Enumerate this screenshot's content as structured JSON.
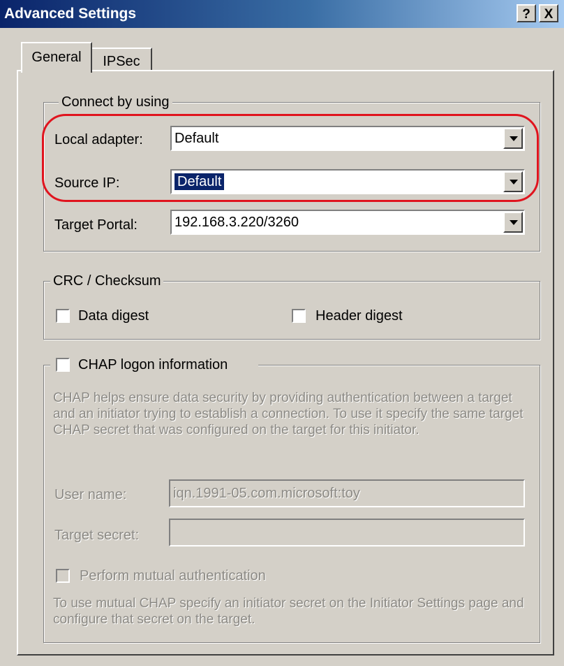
{
  "window": {
    "title": "Advanced Settings",
    "help_button": "?",
    "close_button": "X"
  },
  "tabs": [
    {
      "label": "General",
      "active": true
    },
    {
      "label": "IPSec",
      "active": false
    }
  ],
  "connect_group": {
    "legend": "Connect by using",
    "local_adapter": {
      "label": "Local adapter:",
      "value": "Default"
    },
    "source_ip": {
      "label": "Source IP:",
      "value": "Default"
    },
    "target_portal": {
      "label": "Target Portal:",
      "value": "192.168.3.220/3260"
    }
  },
  "crc_group": {
    "legend": "CRC / Checksum",
    "data_digest": {
      "label": "Data digest",
      "checked": false
    },
    "header_digest": {
      "label": "Header digest",
      "checked": false
    }
  },
  "chap_group": {
    "legend": "CHAP logon information",
    "checked": false,
    "description": "CHAP helps ensure data security by providing authentication between a target and an initiator trying to establish a connection. To use it specify the same target CHAP secret that was configured on the target for this initiator.",
    "user_name": {
      "label": "User name:",
      "value": "iqn.1991-05.com.microsoft:toy"
    },
    "target_secret": {
      "label": "Target secret:",
      "value": ""
    },
    "mutual_auth": {
      "label": "Perform mutual authentication",
      "checked": false
    },
    "mutual_note": "To use mutual CHAP specify an initiator secret on the Initiator Settings page and configure that secret on the target."
  },
  "annotation": {
    "highlight_color": "#e0141e"
  },
  "colors": {
    "face": "#d4d0c8",
    "selection": "#0a246a",
    "title_start": "#0a246a",
    "title_end": "#a6caf0"
  }
}
